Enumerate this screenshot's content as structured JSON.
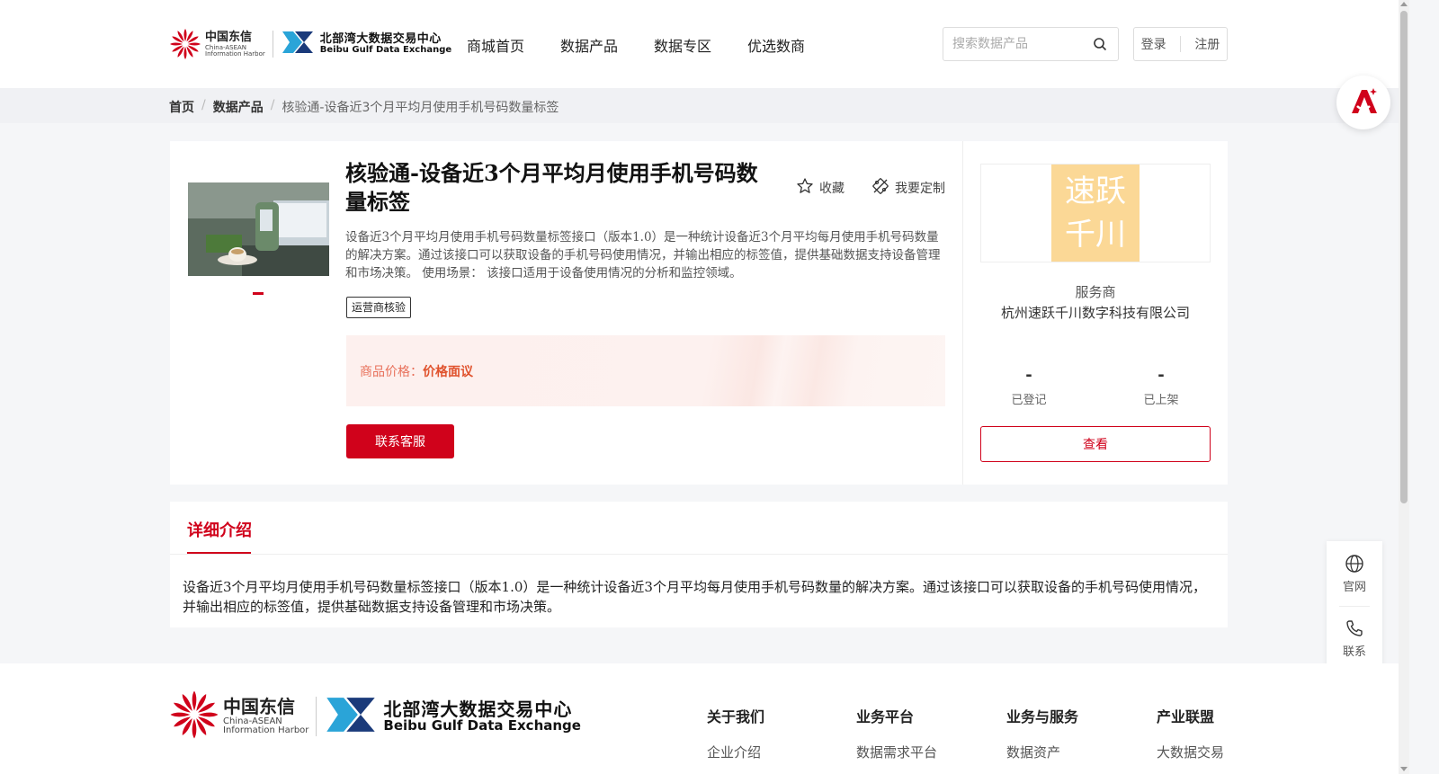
{
  "header": {
    "logo_ct_cn": "中国东信",
    "logo_ct_en1": "China-ASEAN",
    "logo_ct_en2": "Information Harbor",
    "logo_bg_cn": "北部湾大数据交易中心",
    "logo_bg_en": "Beibu Gulf Data Exchange",
    "nav": [
      "商城首页",
      "数据产品",
      "数据专区",
      "优选数商"
    ],
    "search_placeholder": "搜索数据产品",
    "login": "登录",
    "register": "注册"
  },
  "breadcrumb": [
    "首页",
    "数据产品",
    "核验通-设备近3个月平均月使用手机号码数量标签"
  ],
  "product": {
    "title": "核验通-设备近3个月平均月使用手机号码数量标签",
    "favorite": "收藏",
    "customize": "我要定制",
    "description": "设备近3个月平均月使用手机号码数量标签接口（版本1.0）是一种统计设备近3个月平均每月使用手机号码数量的解决方案。通过该接口可以获取设备的手机号码使用情况，并输出相应的标签值，提供基础数据支持设备管理和市场决策。 使用场景： 该接口适用于设备使用情况的分析和监控领域。",
    "tag": "运营商核验",
    "price_label": "商品价格：",
    "price_value": "价格面议",
    "contact_button": "联系客服"
  },
  "provider": {
    "logo_line1": "速跃",
    "logo_line2": "千川",
    "label": "服务商",
    "name": "杭州速跃千川数字科技有限公司",
    "registered_value": "-",
    "registered_label": "已登记",
    "listed_value": "-",
    "listed_label": "已上架",
    "view_button": "查看"
  },
  "detail": {
    "tab": "详细介绍",
    "text": "设备近3个月平均月使用手机号码数量标签接口（版本1.0）是一种统计设备近3个月平均每月使用手机号码数量的解决方案。通过该接口可以获取设备的手机号码使用情况，并输出相应的标签值，提供基础数据支持设备管理和市场决策。"
  },
  "side_tools": {
    "website": "官网",
    "contact": "联系"
  },
  "footer": {
    "columns": [
      {
        "heading": "关于我们",
        "link": "企业介绍"
      },
      {
        "heading": "业务平台",
        "link": "数据需求平台"
      },
      {
        "heading": "业务与服务",
        "link": "数据资产"
      },
      {
        "heading": "产业联盟",
        "link": "大数据交易"
      }
    ]
  },
  "colors": {
    "brand_red": "#d0021b",
    "price_orange": "#e0532e",
    "provider_tile": "#fbd896"
  }
}
